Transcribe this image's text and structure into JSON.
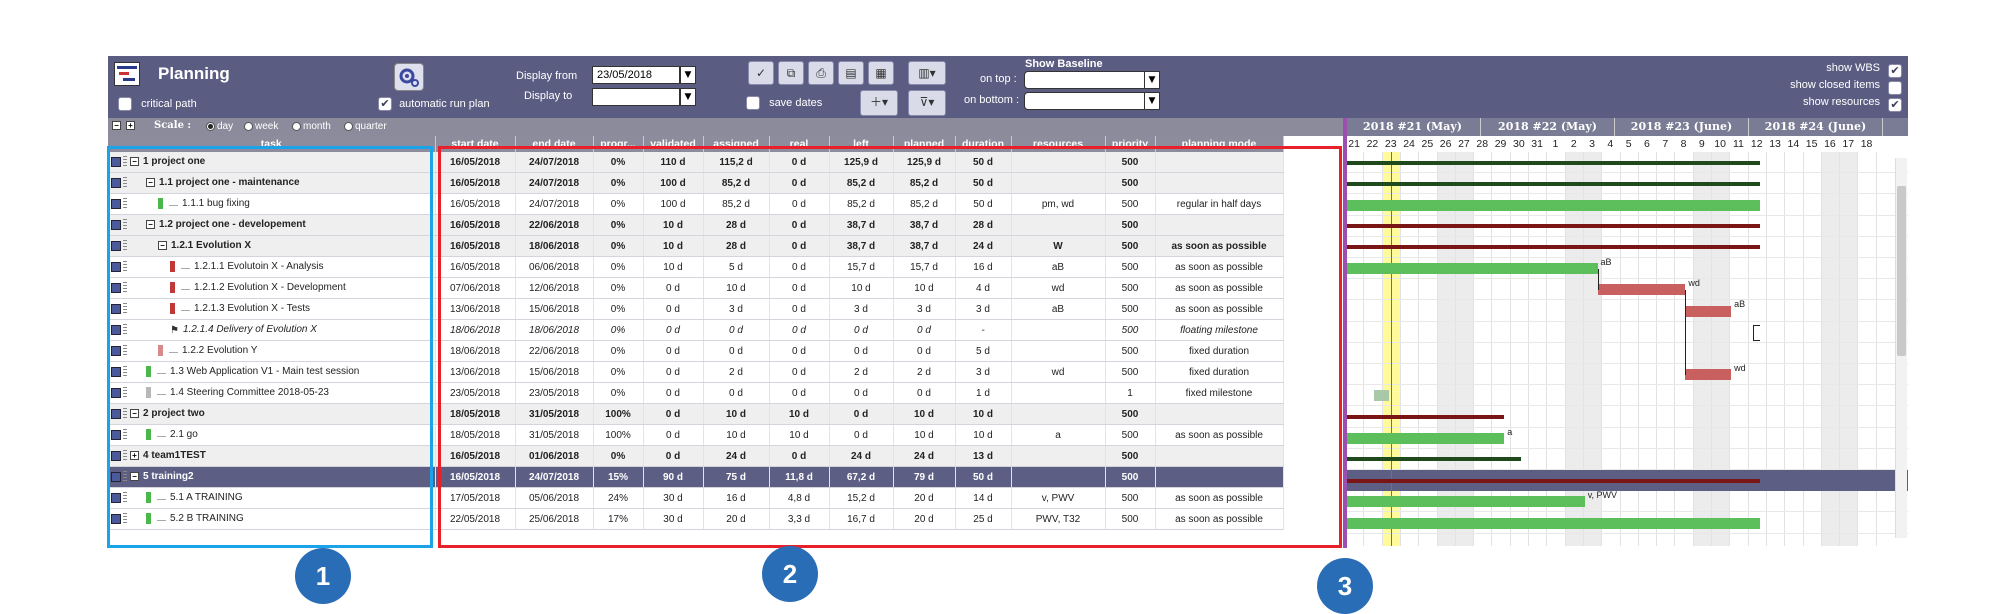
{
  "toolbar": {
    "title": "Planning",
    "critical_path": "critical path",
    "auto_run": "automatic run plan",
    "display_from": "Display from",
    "display_from_value": "23/05/2018",
    "display_to": "Display to",
    "display_to_value": "",
    "save_dates": "save dates",
    "show_baseline": "Show Baseline",
    "on_top": "on top :",
    "on_bottom": "on bottom :",
    "show_wbs": "show WBS",
    "show_closed": "show closed items",
    "show_resources": "show resources"
  },
  "scale": {
    "label": "Scale :",
    "options": [
      "day",
      "week",
      "month",
      "quarter"
    ]
  },
  "columns": [
    "task",
    "start date",
    "end date",
    "progr...",
    "validated",
    "assigned",
    "real",
    "left",
    "planned",
    "duration",
    "resources",
    "priority",
    "planning mode"
  ],
  "rows": [
    {
      "task": "1 project one",
      "start": "16/05/2018",
      "end": "24/07/2018",
      "progress": "0%",
      "validated": "110 d",
      "assigned": "115,2 d",
      "real": "0 d",
      "left": "125,9 d",
      "planned": "125,9 d",
      "duration": "50 d",
      "resources": "",
      "priority": "500",
      "mode": ""
    },
    {
      "task": "1.1 project one - maintenance",
      "start": "16/05/2018",
      "end": "24/07/2018",
      "progress": "0%",
      "validated": "100 d",
      "assigned": "85,2 d",
      "real": "0 d",
      "left": "85,2 d",
      "planned": "85,2 d",
      "duration": "50 d",
      "resources": "",
      "priority": "500",
      "mode": ""
    },
    {
      "task": "1.1.1 bug fixing",
      "start": "16/05/2018",
      "end": "24/07/2018",
      "progress": "0%",
      "validated": "100 d",
      "assigned": "85,2 d",
      "real": "0 d",
      "left": "85,2 d",
      "planned": "85,2 d",
      "duration": "50 d",
      "resources": "pm, wd",
      "priority": "500",
      "mode": "regular in half days"
    },
    {
      "task": "1.2 project one - developement",
      "start": "16/05/2018",
      "end": "22/06/2018",
      "progress": "0%",
      "validated": "10 d",
      "assigned": "28 d",
      "real": "0 d",
      "left": "38,7 d",
      "planned": "38,7 d",
      "duration": "28 d",
      "resources": "",
      "priority": "500",
      "mode": ""
    },
    {
      "task": "1.2.1 Evolution X",
      "start": "16/05/2018",
      "end": "18/06/2018",
      "progress": "0%",
      "validated": "10 d",
      "assigned": "28 d",
      "real": "0 d",
      "left": "38,7 d",
      "planned": "38,7 d",
      "duration": "24 d",
      "resources": "W",
      "priority": "500",
      "mode": "as soon as possible"
    },
    {
      "task": "1.2.1.1 Evolutoin X - Analysis",
      "start": "16/05/2018",
      "end": "06/06/2018",
      "progress": "0%",
      "validated": "10 d",
      "assigned": "5 d",
      "real": "0 d",
      "left": "15,7 d",
      "planned": "15,7 d",
      "duration": "16 d",
      "resources": "aB",
      "priority": "500",
      "mode": "as soon as possible"
    },
    {
      "task": "1.2.1.2 Evolution X - Development",
      "start": "07/06/2018",
      "end": "12/06/2018",
      "progress": "0%",
      "validated": "0 d",
      "assigned": "10 d",
      "real": "0 d",
      "left": "10 d",
      "planned": "10 d",
      "duration": "4 d",
      "resources": "wd",
      "priority": "500",
      "mode": "as soon as possible"
    },
    {
      "task": "1.2.1.3 Evolution X - Tests",
      "start": "13/06/2018",
      "end": "15/06/2018",
      "progress": "0%",
      "validated": "0 d",
      "assigned": "3 d",
      "real": "0 d",
      "left": "3 d",
      "planned": "3 d",
      "duration": "3 d",
      "resources": "aB",
      "priority": "500",
      "mode": "as soon as possible"
    },
    {
      "task": "1.2.1.4 Delivery of Evolution X",
      "start": "18/06/2018",
      "end": "18/06/2018",
      "progress": "0%",
      "validated": "0 d",
      "assigned": "0 d",
      "real": "0 d",
      "left": "0 d",
      "planned": "0 d",
      "duration": "-",
      "resources": "",
      "priority": "500",
      "mode": "floating milestone"
    },
    {
      "task": "1.2.2 Evolution Y",
      "start": "18/06/2018",
      "end": "22/06/2018",
      "progress": "0%",
      "validated": "0 d",
      "assigned": "0 d",
      "real": "0 d",
      "left": "0 d",
      "planned": "0 d",
      "duration": "5 d",
      "resources": "",
      "priority": "500",
      "mode": "fixed duration"
    },
    {
      "task": "1.3 Web Application V1 - Main test session",
      "start": "13/06/2018",
      "end": "15/06/2018",
      "progress": "0%",
      "validated": "0 d",
      "assigned": "2 d",
      "real": "0 d",
      "left": "2 d",
      "planned": "2 d",
      "duration": "3 d",
      "resources": "wd",
      "priority": "500",
      "mode": "fixed duration"
    },
    {
      "task": "1.4 Steering Committee 2018-05-23",
      "start": "23/05/2018",
      "end": "23/05/2018",
      "progress": "0%",
      "validated": "0 d",
      "assigned": "0 d",
      "real": "0 d",
      "left": "0 d",
      "planned": "0 d",
      "duration": "1 d",
      "resources": "",
      "priority": "1",
      "mode": "fixed milestone"
    },
    {
      "task": "2 project two",
      "start": "18/05/2018",
      "end": "31/05/2018",
      "progress": "100%",
      "validated": "0 d",
      "assigned": "10 d",
      "real": "10 d",
      "left": "0 d",
      "planned": "10 d",
      "duration": "10 d",
      "resources": "",
      "priority": "500",
      "mode": ""
    },
    {
      "task": "2.1 go",
      "start": "18/05/2018",
      "end": "31/05/2018",
      "progress": "100%",
      "validated": "0 d",
      "assigned": "10 d",
      "real": "10 d",
      "left": "0 d",
      "planned": "10 d",
      "duration": "10 d",
      "resources": "a",
      "priority": "500",
      "mode": "as soon as possible"
    },
    {
      "task": "4 team1TEST",
      "start": "16/05/2018",
      "end": "01/06/2018",
      "progress": "0%",
      "validated": "0 d",
      "assigned": "24 d",
      "real": "0 d",
      "left": "24 d",
      "planned": "24 d",
      "duration": "13 d",
      "resources": "",
      "priority": "500",
      "mode": ""
    },
    {
      "task": "5 training2",
      "start": "16/05/2018",
      "end": "24/07/2018",
      "progress": "15%",
      "validated": "90 d",
      "assigned": "75 d",
      "real": "11,8 d",
      "left": "67,2 d",
      "planned": "79 d",
      "duration": "50 d",
      "resources": "",
      "priority": "500",
      "mode": ""
    },
    {
      "task": "5.1 A TRAINING",
      "start": "17/05/2018",
      "end": "05/06/2018",
      "progress": "24%",
      "validated": "30 d",
      "assigned": "16 d",
      "real": "4,8 d",
      "left": "15,2 d",
      "planned": "20 d",
      "duration": "14 d",
      "resources": "v, PWV",
      "priority": "500",
      "mode": "as soon as possible"
    },
    {
      "task": "5.2 B TRAINING",
      "start": "22/05/2018",
      "end": "25/06/2018",
      "progress": "17%",
      "validated": "30 d",
      "assigned": "20 d",
      "real": "3,3 d",
      "left": "16,7 d",
      "planned": "20 d",
      "duration": "25 d",
      "resources": "PWV, T32",
      "priority": "500",
      "mode": "as soon as possible"
    }
  ],
  "weeks": [
    "2018 #21 (May)",
    "2018 #22 (May)",
    "2018 #23 (June)",
    "2018 #24 (June)"
  ],
  "days": [
    "21",
    "22",
    "23",
    "24",
    "25",
    "26",
    "27",
    "28",
    "29",
    "30",
    "31",
    "1",
    "2",
    "3",
    "4",
    "5",
    "6",
    "7",
    "8",
    "9",
    "10",
    "11",
    "12",
    "13",
    "14",
    "15",
    "16",
    "17",
    "18"
  ],
  "gantt_labels": {
    "analysis": "aB",
    "dev": "wd",
    "tests": "aB",
    "test_session": "wd",
    "go": "a",
    "training_a": "v, PWV"
  },
  "annotations": [
    "1",
    "2",
    "3"
  ],
  "colors": {
    "header": "#5b5c82",
    "task_box": "#1aa3e8",
    "data_box": "#e8202a",
    "gantt_line": "#9b4fb0",
    "bar_green": "#5cbf5c",
    "bar_red": "#c96060",
    "summary": "#7a1515"
  }
}
